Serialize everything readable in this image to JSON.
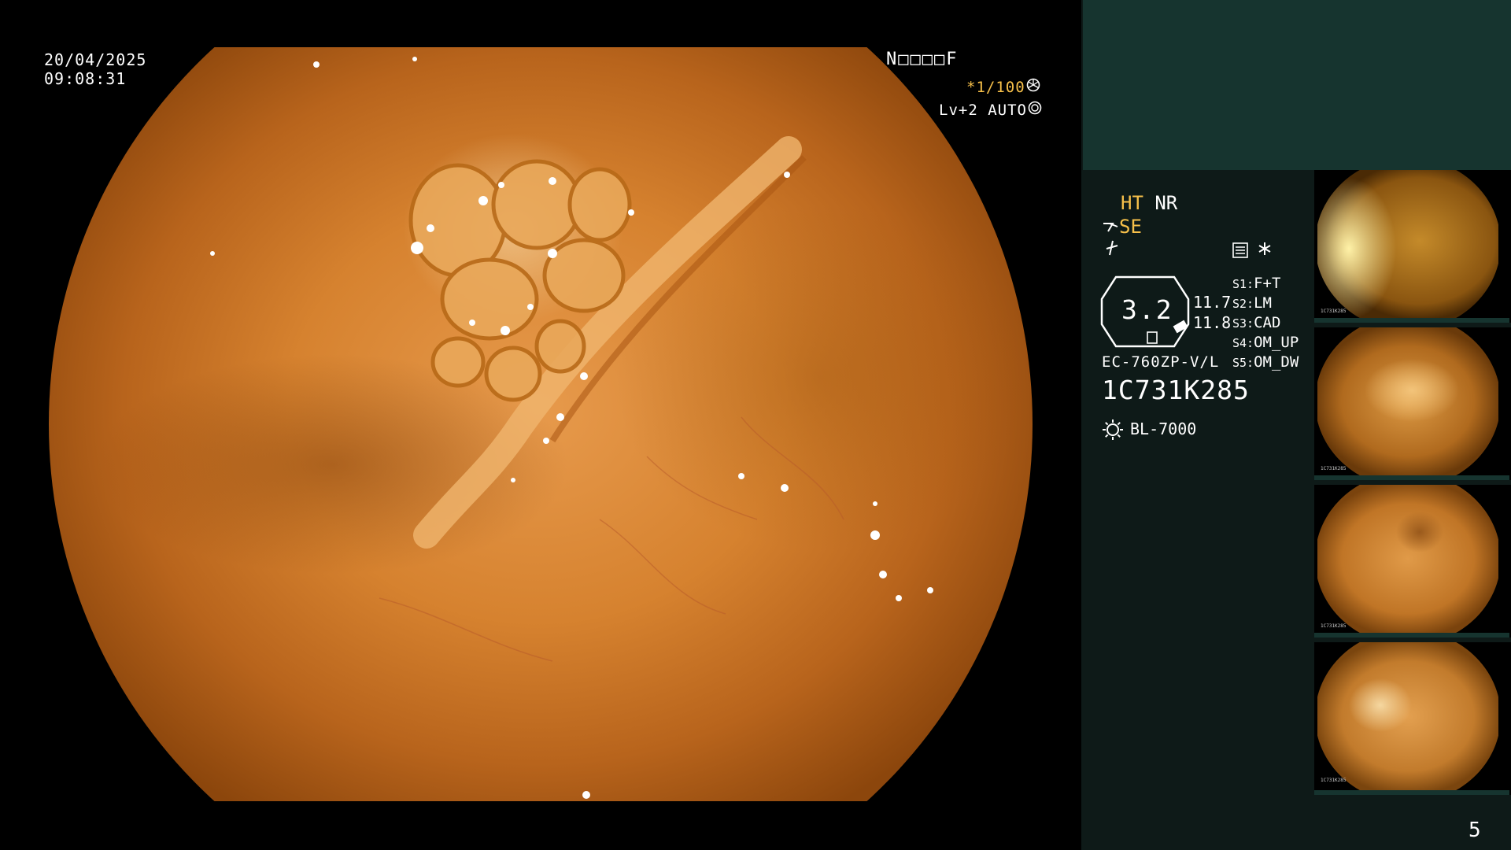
{
  "overlay": {
    "date": "20/04/2025",
    "time": "09:08:31",
    "patient_code": "N□□□□F",
    "zoom": "*1/100",
    "level": "Lv+2",
    "mode": "AUTO"
  },
  "status_panel": {
    "ht_label": "HT",
    "nr_label": "NR",
    "se_label": "SE",
    "gauge_value": "3.2",
    "gauge_num_1": "11.7",
    "gauge_num_2": "11.8",
    "settings": [
      {
        "key": "S1:",
        "value": "F+T"
      },
      {
        "key": "S2:",
        "value": "LM"
      },
      {
        "key": "S3:",
        "value": "CAD"
      },
      {
        "key": "S4:",
        "value": "OM_UP"
      },
      {
        "key": "S5:",
        "value": "OM_DW"
      }
    ],
    "scope_model": "EC-760ZP-V/L",
    "serial_number": "1C731K285",
    "light_source": "BL-7000"
  },
  "thumbnails": [
    {
      "code": "1C731K285"
    },
    {
      "code": "1C731K285"
    },
    {
      "code": "1C731K285"
    },
    {
      "code": "1C731K285"
    }
  ],
  "page_number": "5",
  "colors": {
    "accent_yellow": "#f7c04a",
    "panel_dark": "#0e1a18",
    "panel_teal": "#16342f",
    "mucosa": "#d6822f"
  },
  "icons": [
    "shutter-icon",
    "iris-icon",
    "cut-icon",
    "bolt-icon",
    "memory-icon",
    "star-icon",
    "light-icon"
  ]
}
